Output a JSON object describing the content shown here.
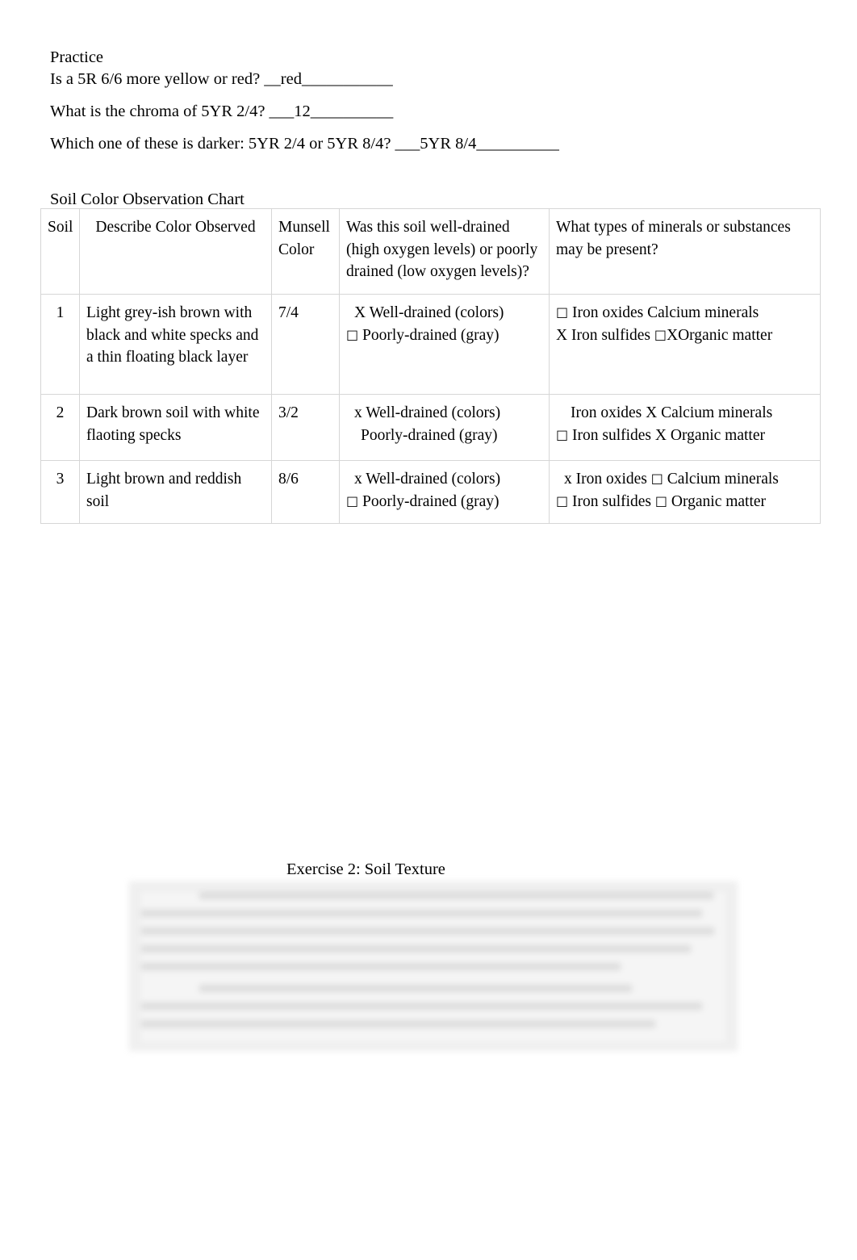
{
  "practice": {
    "heading": "Practice",
    "q1": "Is a 5R 6/6 more yellow or red? __red___________",
    "q2": "What is the chroma of 5YR 2/4? ___12__________",
    "q3": "Which one of these is darker: 5YR 2/4 or 5YR 8/4? ___5YR 8/4__________"
  },
  "chart": {
    "caption": "Soil Color Observation Chart",
    "headers": {
      "soil": "Soil",
      "describe": "Describe Color Observed",
      "munsell": "Munsell Color",
      "drainage": "Was this soil well-drained   (high oxygen levels) or poorly   drained (low oxygen levels)?",
      "minerals": "What types of minerals or substances   may be present?"
    },
    "rows": [
      {
        "num": "1",
        "description": "Light grey-ish brown with black and white specks and a thin floating black layer",
        "munsell": "7/4",
        "drain_well": "X Well-drained (colors)",
        "drain_poor_box": "□",
        "drain_poor": " Poorly-drained (gray)",
        "min_line1_box": "□",
        "min_line1": " Iron oxides  Calcium minerals",
        "min_line2": " X Iron sulfides ",
        "min_line2_box": "□",
        "min_line2_tail": "XOrganic matter"
      },
      {
        "num": "2",
        "description": "Dark brown soil with white flaoting specks",
        "munsell": "3/2",
        "drain_well": "x Well-drained (colors)",
        "drain_poor_box": "",
        "drain_poor": " Poorly-drained (gray)",
        "min_line1_box": "",
        "min_line1": " Iron oxides X Calcium minerals",
        "min_line2_box": "□",
        "min_line2": " Iron sulfides X Organic matter"
      },
      {
        "num": "3",
        "description": "Light brown and reddish soil",
        "munsell": "8/6",
        "drain_well": "x Well-drained (colors)",
        "drain_poor_box": "□",
        "drain_poor": " Poorly-drained (gray)",
        "min_line1_pre": "x Iron oxides ",
        "min_line1_box": "□",
        "min_line1": " Calcium minerals",
        "min_line2_box": "□",
        "min_line2": " Iron sulfides ",
        "min_line2_box2": "□",
        "min_line2_tail": " Organic matter"
      }
    ]
  },
  "exercise2": {
    "title": "Exercise 2: Soil Texture",
    "figure_note": ""
  }
}
